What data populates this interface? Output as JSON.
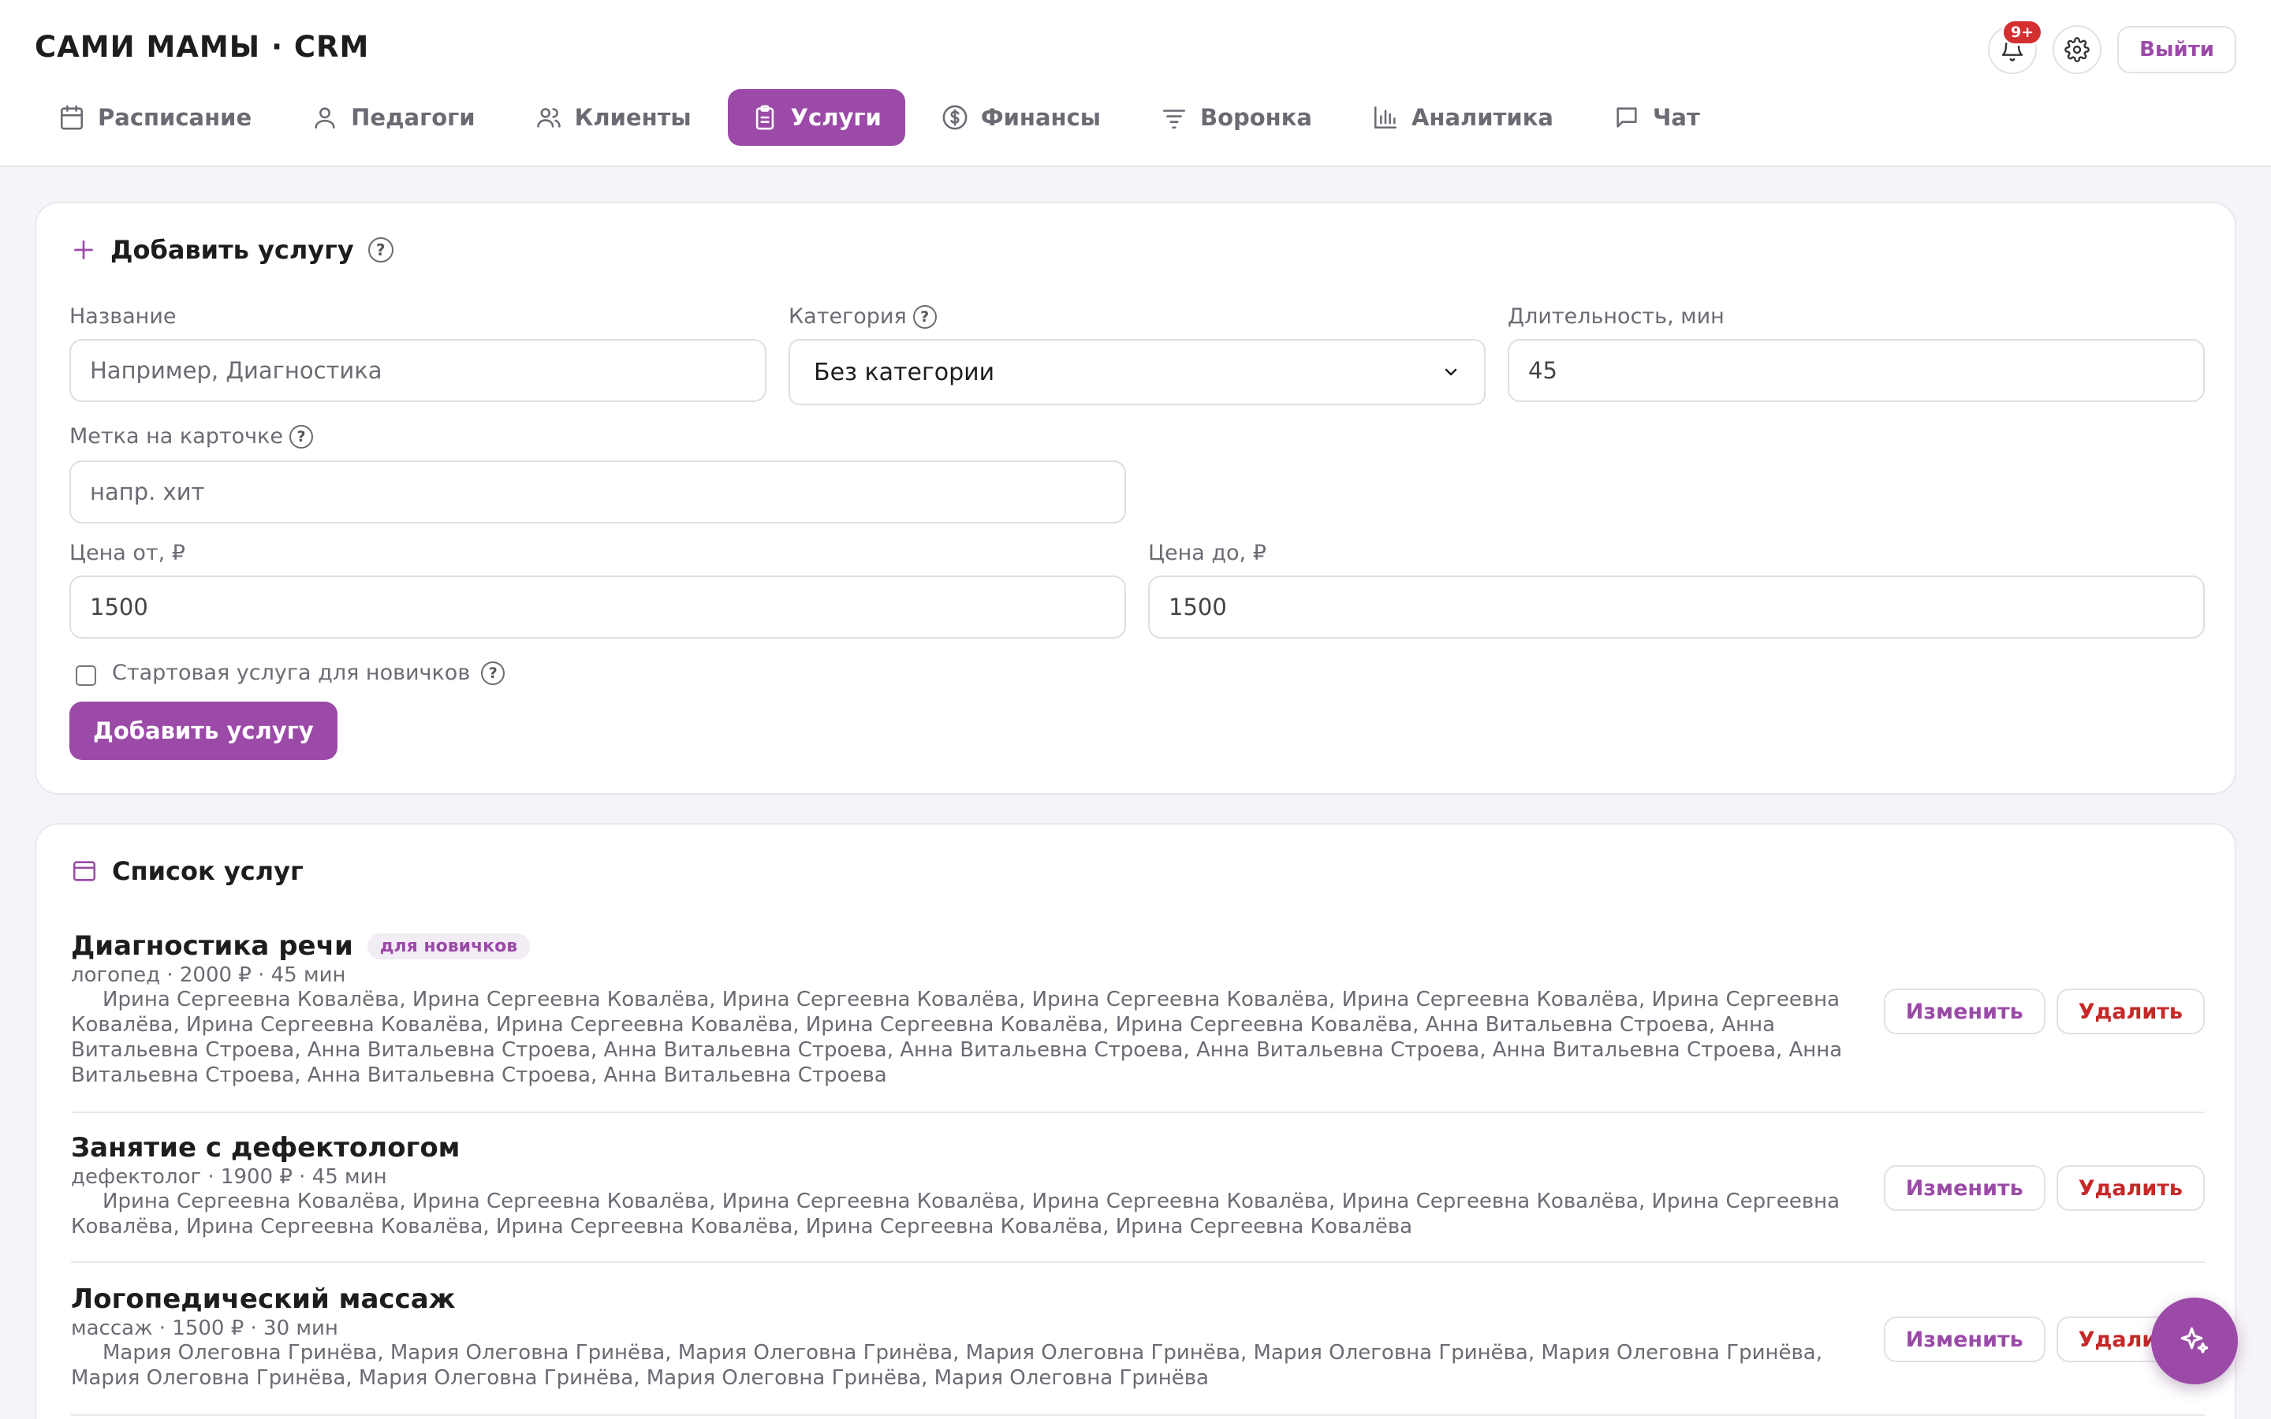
{
  "app": {
    "title": "САМИ МАМЫ · CRM"
  },
  "header": {
    "notifications_badge": "9+",
    "logout_label": "Выйти"
  },
  "nav": {
    "items": [
      {
        "label": "Расписание",
        "icon": "calendar-icon"
      },
      {
        "label": "Педагоги",
        "icon": "user-icon"
      },
      {
        "label": "Клиенты",
        "icon": "users-icon"
      },
      {
        "label": "Услуги",
        "icon": "clipboard-icon",
        "active": true
      },
      {
        "label": "Финансы",
        "icon": "dollar-icon"
      },
      {
        "label": "Воронка",
        "icon": "filter-icon"
      },
      {
        "label": "Аналитика",
        "icon": "bar-chart-icon"
      },
      {
        "label": "Чат",
        "icon": "message-icon"
      }
    ]
  },
  "add_form": {
    "title": "Добавить услугу",
    "name_label": "Название",
    "name_placeholder": "Например, Диагностика",
    "category_label": "Категория",
    "category_value": "Без категории",
    "duration_label": "Длительность, мин",
    "duration_value": "45",
    "tag_label": "Метка на карточке",
    "tag_placeholder": "напр. хит",
    "price_from_label": "Цена от, ₽",
    "price_from_value": "1500",
    "price_to_label": "Цена до, ₽",
    "price_to_value": "1500",
    "starter_label": "Стартовая услуга для новичков",
    "submit_label": "Добавить услугу"
  },
  "list": {
    "title": "Список услуг",
    "edit_label": "Изменить",
    "delete_label": "Удалить",
    "services": [
      {
        "name": "Диагностика речи",
        "badge": "для новичков",
        "meta": "логопед · 2000 ₽ · 45 мин",
        "staff": "Ирина Сергеевна Ковалёва, Ирина Сергеевна Ковалёва, Ирина Сергеевна Ковалёва, Ирина Сергеевна Ковалёва, Ирина Сергеевна Ковалёва, Ирина Сергеевна Ковалёва, Ирина Сергеевна Ковалёва, Ирина Сергеевна Ковалёва, Ирина Сергеевна Ковалёва, Ирина Сергеевна Ковалёва, Анна Витальевна Строева, Анна Витальевна Строева, Анна Витальевна Строева, Анна Витальевна Строева, Анна Витальевна Строева, Анна Витальевна Строева, Анна Витальевна Строева, Анна Витальевна Строева, Анна Витальевна Строева, Анна Витальевна Строева"
      },
      {
        "name": "Занятие с дефектологом",
        "meta": "дефектолог · 1900 ₽ · 45 мин",
        "staff": "Ирина Сергеевна Ковалёва, Ирина Сергеевна Ковалёва, Ирина Сергеевна Ковалёва, Ирина Сергеевна Ковалёва, Ирина Сергеевна Ковалёва, Ирина Сергеевна Ковалёва, Ирина Сергеевна Ковалёва, Ирина Сергеевна Ковалёва, Ирина Сергеевна Ковалёва, Ирина Сергеевна Ковалёва"
      },
      {
        "name": "Логопедический массаж",
        "meta": "массаж · 1500 ₽ · 30 мин",
        "staff": "Мария Олеговна Гринёва, Мария Олеговна Гринёва, Мария Олеговна Гринёва, Мария Олеговна Гринёва, Мария Олеговна Гринёва, Мария Олеговна Гринёва, Мария Олеговна Гринёва, Мария Олеговна Гринёва, Мария Олеговна Гринёва, Мария Олеговна Гринёва"
      }
    ]
  },
  "colors": {
    "accent": "#9b4aa8",
    "danger": "#c62828",
    "badge_red": "#d32f2f"
  }
}
